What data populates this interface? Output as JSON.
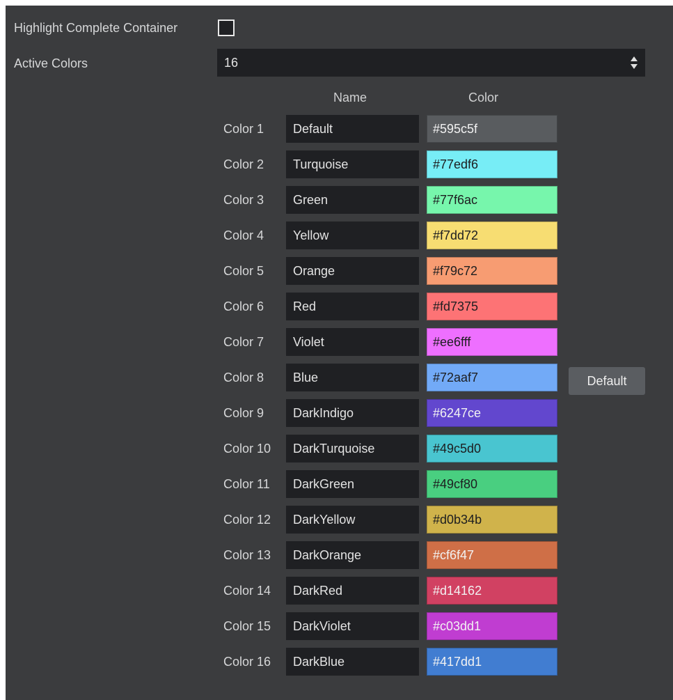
{
  "highlight": {
    "label": "Highlight Complete Container",
    "checked": false
  },
  "active_colors": {
    "label": "Active Colors",
    "value": "16"
  },
  "table": {
    "name_header": "Name",
    "color_header": "Color",
    "rows": [
      {
        "label": "Color 1",
        "name": "Default",
        "hex": "#595c5f"
      },
      {
        "label": "Color 2",
        "name": "Turquoise",
        "hex": "#77edf6"
      },
      {
        "label": "Color 3",
        "name": "Green",
        "hex": "#77f6ac"
      },
      {
        "label": "Color 4",
        "name": "Yellow",
        "hex": "#f7dd72"
      },
      {
        "label": "Color 5",
        "name": "Orange",
        "hex": "#f79c72"
      },
      {
        "label": "Color 6",
        "name": "Red",
        "hex": "#fd7375"
      },
      {
        "label": "Color 7",
        "name": "Violet",
        "hex": "#ee6fff"
      },
      {
        "label": "Color 8",
        "name": "Blue",
        "hex": "#72aaf7"
      },
      {
        "label": "Color 9",
        "name": "DarkIndigo",
        "hex": "#6247ce"
      },
      {
        "label": "Color 10",
        "name": "DarkTurquoise",
        "hex": "#49c5d0"
      },
      {
        "label": "Color 11",
        "name": "DarkGreen",
        "hex": "#49cf80"
      },
      {
        "label": "Color 12",
        "name": "DarkYellow",
        "hex": "#d0b34b"
      },
      {
        "label": "Color 13",
        "name": "DarkOrange",
        "hex": "#cf6f47"
      },
      {
        "label": "Color 14",
        "name": "DarkRed",
        "hex": "#d14162"
      },
      {
        "label": "Color 15",
        "name": "DarkViolet",
        "hex": "#c03dd1"
      },
      {
        "label": "Color 16",
        "name": "DarkBlue",
        "hex": "#417dd1"
      }
    ]
  },
  "default_button": {
    "label": "Default"
  }
}
